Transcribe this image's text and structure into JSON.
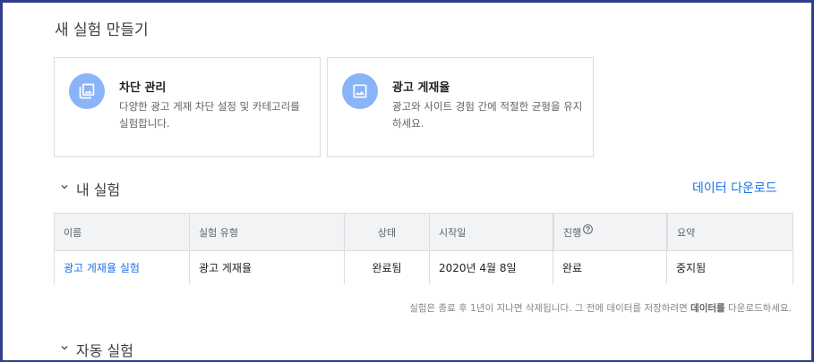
{
  "page_title": "새 실험 만들기",
  "cards": [
    {
      "title": "차단 관리",
      "description": "다양한 광고 게재 차단 설정 및 카테고리를 실험합니다.",
      "icon": "image-icon"
    },
    {
      "title": "광고 게재율",
      "description": "광고와 사이트 경험 간에 적절한 균형을 유지하세요.",
      "icon": "image-icon"
    }
  ],
  "my_experiments": {
    "heading": "내 실험",
    "download_label": "데이터 다운로드",
    "columns": [
      "이름",
      "실험 유형",
      "상태",
      "시작일",
      "진행",
      "요약"
    ],
    "rows": [
      {
        "name": "광고 게재율 실험",
        "type": "광고 게재율",
        "status": "완료됨",
        "start_date": "2020년 4월 8일",
        "progress": "완료",
        "summary": "중지됨"
      }
    ],
    "footnote_prefix": "실험은 종료 후 1년이 지나면 삭제됩니다. 그 전에 데이터를 저장하려면 ",
    "footnote_bold": "데이터를",
    "footnote_suffix": " 다운로드하세요."
  },
  "auto_experiments": {
    "heading": "자동 실험"
  },
  "colors": {
    "accent": "#1a73e8",
    "icon_circle": "#8ab4f8",
    "border": "#dadce0",
    "header_bg": "#f1f3f4",
    "frame": "#2f3d8c"
  }
}
